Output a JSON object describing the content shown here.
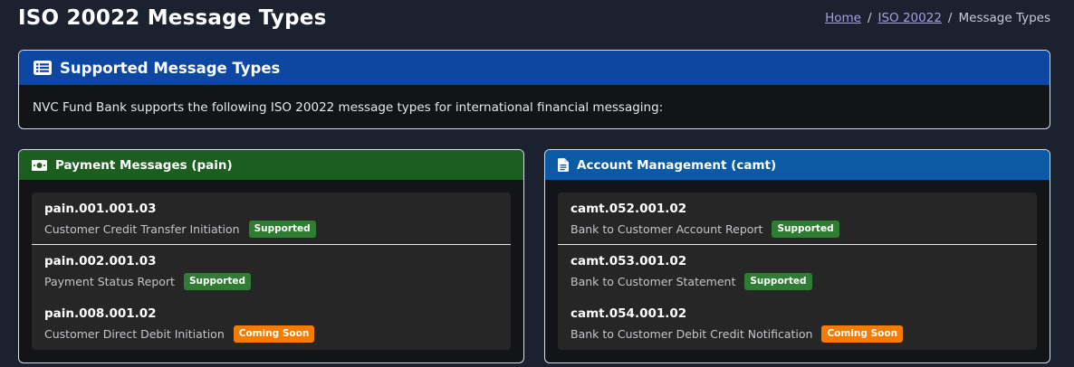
{
  "page": {
    "title": "ISO 20022 Message Types"
  },
  "breadcrumb": {
    "items": [
      {
        "label": "Home",
        "link": true
      },
      {
        "label": "ISO 20022",
        "link": true
      },
      {
        "label": "Message Types",
        "link": false
      }
    ]
  },
  "intro": {
    "title": "Supported Message Types",
    "icon": "list-icon",
    "text": "NVC Fund Bank supports the following ISO 20022 message types for international financial messaging:"
  },
  "pain": {
    "title": "Payment Messages (pain)",
    "icon": "money-icon",
    "color": "#1b5e20",
    "messages": [
      {
        "code": "pain.001.001.03",
        "desc": "Customer Credit Transfer Initiation",
        "status": "Supported"
      },
      {
        "code": "pain.002.001.03",
        "desc": "Payment Status Report",
        "status": "Supported"
      },
      {
        "code": "pain.008.001.02",
        "desc": "Customer Direct Debit Initiation",
        "status": "Coming Soon"
      }
    ]
  },
  "camt": {
    "title": "Account Management (camt)",
    "icon": "document-icon",
    "color": "#0a5aa6",
    "messages": [
      {
        "code": "camt.052.001.02",
        "desc": "Bank to Customer Account Report",
        "status": "Supported"
      },
      {
        "code": "camt.053.001.02",
        "desc": "Bank to Customer Statement",
        "status": "Supported"
      },
      {
        "code": "camt.054.001.02",
        "desc": "Bank to Customer Debit Credit Notification",
        "status": "Coming Soon"
      }
    ]
  },
  "colors": {
    "background": "#1c2130",
    "intro_header": "#0d47a1",
    "supported": "#2e7d32",
    "coming_soon": "#f57c00"
  }
}
